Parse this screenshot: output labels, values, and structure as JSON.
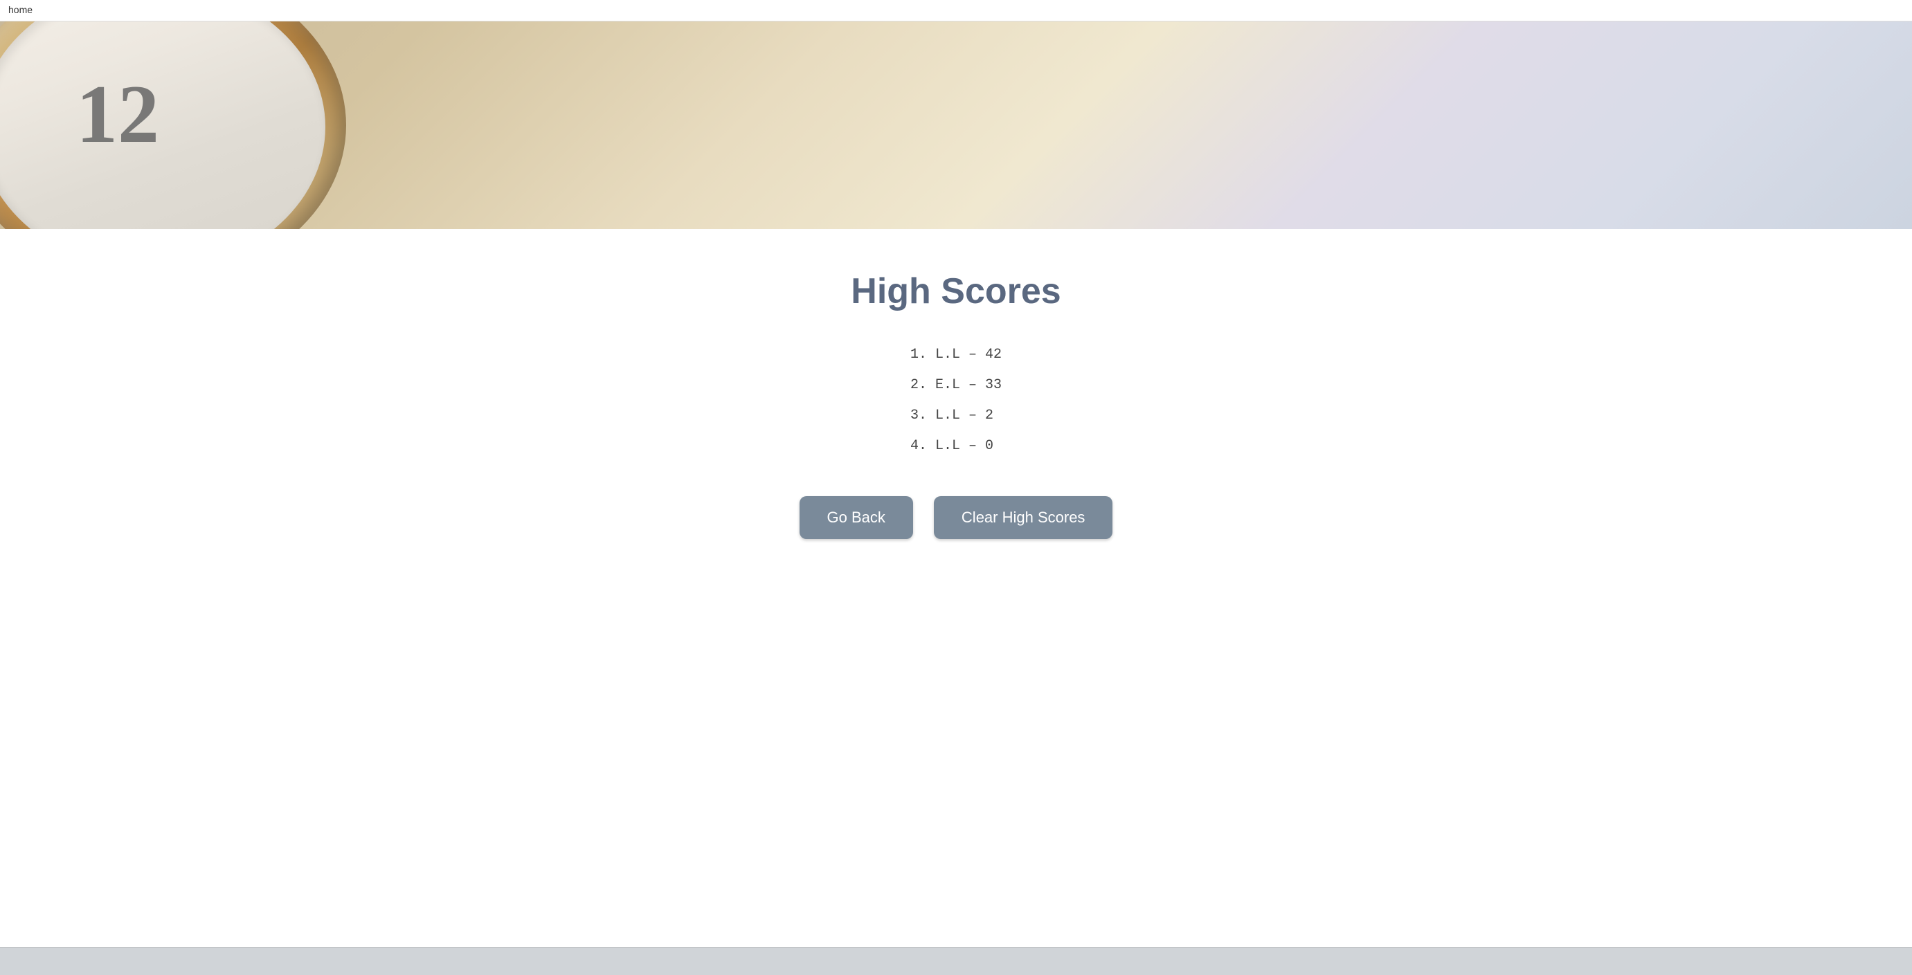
{
  "nav": {
    "home_label": "home"
  },
  "page": {
    "title": "High Scores"
  },
  "scores": [
    {
      "rank": "1.",
      "entry": "L.L – 42"
    },
    {
      "rank": "2.",
      "entry": "E.L – 33"
    },
    {
      "rank": "3.",
      "entry": "L.L – 2"
    },
    {
      "rank": "4.",
      "entry": "L.L – 0"
    }
  ],
  "buttons": {
    "go_back": "Go Back",
    "clear_scores": "Clear High Scores"
  }
}
